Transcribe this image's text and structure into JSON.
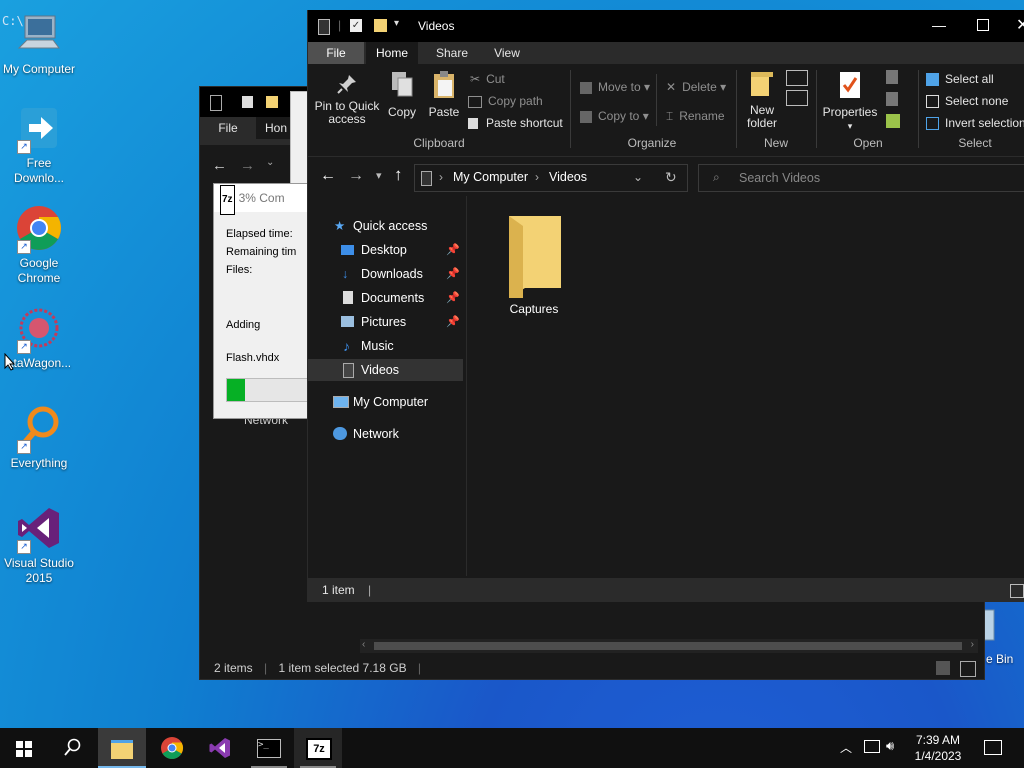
{
  "desktop": {
    "icons": [
      {
        "label": "My Computer",
        "icon": "computer-icon"
      },
      {
        "label": "Free Downlo...",
        "icon": "download-manager-icon"
      },
      {
        "label": "Google Chrome",
        "icon": "chrome-icon"
      },
      {
        "label": "ataWagon...",
        "icon": "datawagon-icon"
      },
      {
        "label": "Everything",
        "icon": "everything-search-icon"
      },
      {
        "label": "Visual Studio 2015",
        "icon": "visual-studio-icon"
      }
    ],
    "recycle_bin_label": "e Bin"
  },
  "back_window": {
    "tab_file": "File",
    "tab_home": "Hon",
    "network_label": "Network",
    "status_items": "2 items",
    "status_selected": "1 item selected  7.18 GB"
  },
  "zip_dialog": {
    "title": "3% Com",
    "elapsed_label": "Elapsed time:",
    "remaining_label": "Remaining tim",
    "files_label": "Files:",
    "adding_label": "Adding",
    "file_name": "Flash.vhdx",
    "progress_percent": 3
  },
  "main_window": {
    "title": "Videos",
    "tabs": [
      "File",
      "Home",
      "Share",
      "View"
    ],
    "active_tab": "Home",
    "ribbon": {
      "clipboard": {
        "pin": "Pin to Quick access",
        "copy": "Copy",
        "paste": "Paste",
        "cut": "Cut",
        "copy_path": "Copy path",
        "paste_shortcut": "Paste shortcut",
        "group": "Clipboard"
      },
      "organize": {
        "move_to": "Move to",
        "copy_to": "Copy to",
        "delete": "Delete",
        "rename": "Rename",
        "group": "Organize"
      },
      "new": {
        "new_folder": "New folder",
        "group": "New"
      },
      "open": {
        "properties": "Properties",
        "group": "Open"
      },
      "select": {
        "select_all": "Select all",
        "select_none": "Select none",
        "invert": "Invert selection",
        "group": "Select"
      }
    },
    "address": {
      "part1": "My Computer",
      "part2": "Videos",
      "search_placeholder": "Search Videos"
    },
    "nav_pane": [
      {
        "label": "Quick access",
        "icon": "star-icon",
        "pinned": false
      },
      {
        "label": "Desktop",
        "icon": "desktop-icon",
        "pinned": true
      },
      {
        "label": "Downloads",
        "icon": "download-arrow-icon",
        "pinned": true
      },
      {
        "label": "Documents",
        "icon": "document-icon",
        "pinned": true
      },
      {
        "label": "Pictures",
        "icon": "picture-icon",
        "pinned": true
      },
      {
        "label": "Music",
        "icon": "music-note-icon",
        "pinned": false
      },
      {
        "label": "Videos",
        "icon": "video-icon",
        "pinned": false
      },
      {
        "label": "My Computer",
        "icon": "computer-icon",
        "pinned": false
      },
      {
        "label": "Network",
        "icon": "network-icon",
        "pinned": false
      }
    ],
    "selected_nav": "Videos",
    "items": [
      {
        "name": "Captures",
        "type": "folder"
      }
    ],
    "status": "1 item"
  },
  "taskbar": {
    "time": "7:39 AM",
    "date": "1/4/2023",
    "apps": [
      "file-explorer-icon",
      "chrome-icon",
      "visual-studio-icon",
      "terminal-icon",
      "7zip-icon"
    ]
  },
  "colors": {
    "accent": "#76b9ed",
    "progress_green": "#06b025",
    "folder_yellow": "#f3d274"
  }
}
